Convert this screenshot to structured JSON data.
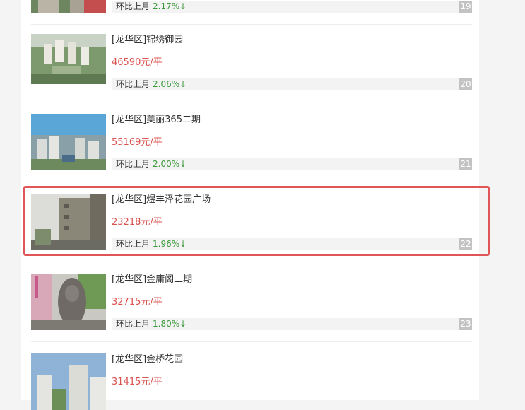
{
  "listings": [
    {
      "district": "",
      "name": "",
      "price": "",
      "change_label": "环比上月",
      "change": "2.17%",
      "arrow": "↓",
      "rank": "19"
    },
    {
      "district": "[龙华区]",
      "name": "锦绣御园",
      "price": "46590元/平",
      "change_label": "环比上月",
      "change": "2.06%",
      "arrow": "↓",
      "rank": "20"
    },
    {
      "district": "[龙华区]",
      "name": "美丽365二期",
      "price": "55169元/平",
      "change_label": "环比上月",
      "change": "2.00%",
      "arrow": "↓",
      "rank": "21"
    },
    {
      "district": "[龙华区]",
      "name": "煜丰泽花园广场",
      "price": "23218元/平",
      "change_label": "环比上月",
      "change": "1.96%",
      "arrow": "↓",
      "rank": "22"
    },
    {
      "district": "[龙华区]",
      "name": "金庸阁二期",
      "price": "32715元/平",
      "change_label": "环比上月",
      "change": "1.80%",
      "arrow": "↓",
      "rank": "23"
    },
    {
      "district": "[龙华区]",
      "name": "金桥花园",
      "price": "31415元/平",
      "change_label": "",
      "change": "",
      "arrow": "",
      "rank": ""
    }
  ],
  "colors": {
    "price": "#d9534f",
    "change": "#3a9a3a",
    "highlight": "#e05656",
    "rank_bg": "#c3c3c3"
  }
}
